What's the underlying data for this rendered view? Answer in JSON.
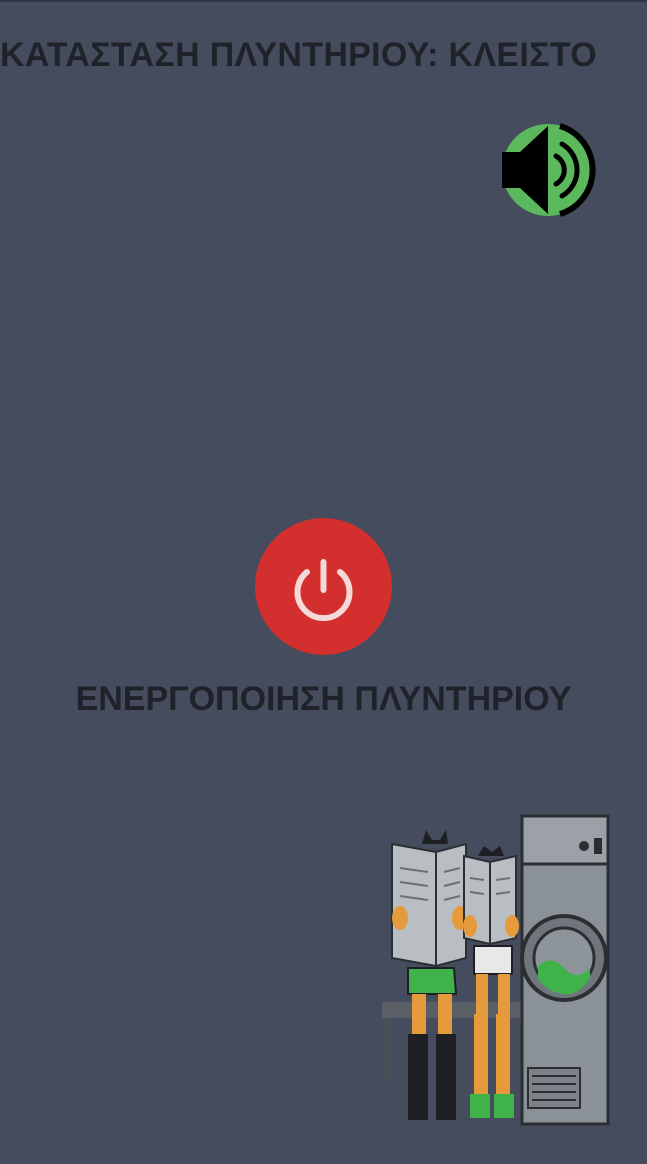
{
  "status": {
    "text": "ΚΑΤΑΣΤΑΣΗ ΠΛΥΝΤΗΡΙΟΥ: ΚΛΕΙΣΤΟ"
  },
  "sound": {
    "icon": "speaker-icon",
    "color_primary": "#000000",
    "color_accent": "#5cb85c"
  },
  "power": {
    "icon": "power-icon",
    "button_color": "#d32f2f",
    "label": "ΕΝΕΡΓΟΠΟΙΗΣΗ ΠΛΥΝΤΗΡΙΟΥ"
  },
  "illustration": {
    "icon": "laundromat-illustration"
  },
  "theme": {
    "background": "#454c5e",
    "text": "#1f2229"
  }
}
